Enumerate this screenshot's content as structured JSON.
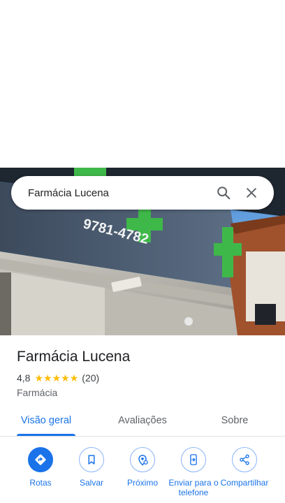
{
  "search": {
    "query": "Farmácia Lucena"
  },
  "place": {
    "name": "Farmácia Lucena",
    "rating": "4,8",
    "stars": 5,
    "review_count": "(20)",
    "category": "Farmácia"
  },
  "tabs": [
    {
      "label": "Visão geral",
      "active": true
    },
    {
      "label": "Avaliações",
      "active": false
    },
    {
      "label": "Sobre",
      "active": false
    }
  ],
  "actions": [
    {
      "label": "Rotas",
      "icon": "directions-icon"
    },
    {
      "label": "Salvar",
      "icon": "bookmark-icon"
    },
    {
      "label": "Próximo",
      "icon": "nearby-icon"
    },
    {
      "label": "Enviar para o telefone",
      "icon": "send-to-phone-icon"
    },
    {
      "label": "Compartilhar",
      "icon": "share-icon"
    }
  ],
  "photo": {
    "sign_text": "9781-4782"
  },
  "colors": {
    "accent": "#1a73e8",
    "star": "#fbbc04"
  }
}
